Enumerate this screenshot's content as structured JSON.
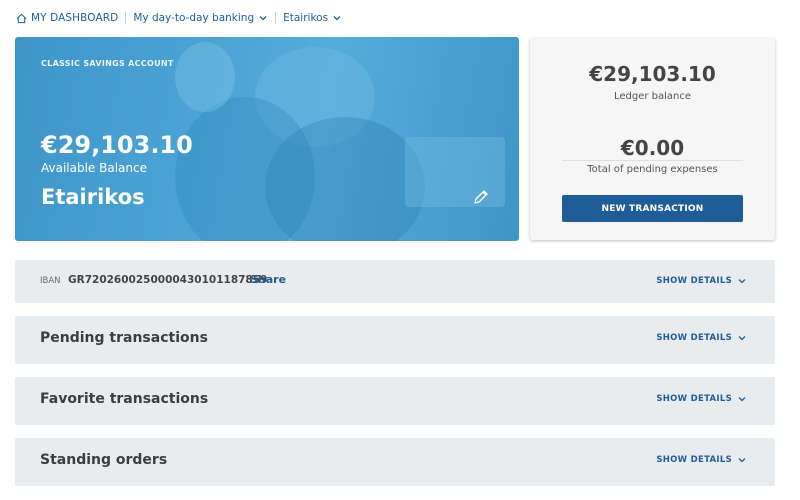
{
  "breadcrumb": {
    "home": "MY DASHBOARD",
    "section": "My day-to-day banking",
    "account": "Etairikos"
  },
  "hero": {
    "account_type": "CLASSIC SAVINGS ACCOUNT",
    "available_balance": "€29,103.10",
    "available_label": "Available Balance",
    "nickname": "Etairikos"
  },
  "summary": {
    "ledger_amount": "€29,103.10",
    "ledger_label": "Ledger balance",
    "pending_amount": "€0.00",
    "pending_label": "Total of pending expenses",
    "new_transaction": "NEW TRANSACTION"
  },
  "iban": {
    "label": "IBAN",
    "value": "GR7202600250000430101187859",
    "share": "Share",
    "show_details": "SHOW DETAILS"
  },
  "sections": [
    {
      "title": "Pending transactions",
      "show_details": "SHOW DETAILS"
    },
    {
      "title": "Favorite transactions",
      "show_details": "SHOW DETAILS"
    },
    {
      "title": "Standing orders",
      "show_details": "SHOW DETAILS"
    }
  ],
  "colors": {
    "brand_blue": "#1f5d99",
    "hero_blue": "#4aa3d4",
    "row_bg": "#e8ecee"
  }
}
